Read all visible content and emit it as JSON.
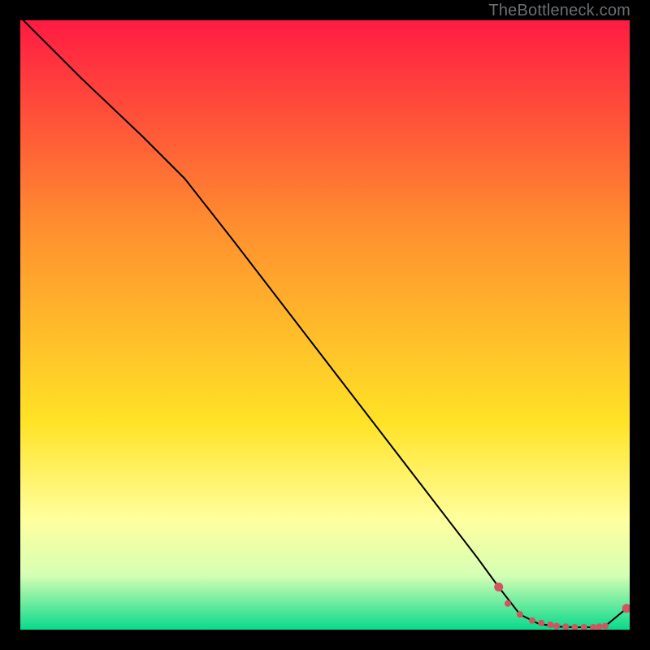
{
  "attribution": "TheBottleneck.com",
  "colors": {
    "gradient_top": "#ff1b43",
    "gradient_mid1": "#ff8f2f",
    "gradient_mid2": "#ffe326",
    "gradient_pale": "#ffff9e",
    "gradient_bottom": "#09d98c",
    "line": "#000000",
    "marker": "#d2545f"
  },
  "chart_data": {
    "type": "line",
    "title": "",
    "xlabel": "",
    "ylabel": "",
    "xlim": [
      0,
      100
    ],
    "ylim": [
      0,
      100
    ],
    "series": [
      {
        "name": "curve",
        "x": [
          0.5,
          10,
          20,
          27,
          35,
          45,
          55,
          65,
          75,
          78.5,
          82,
          85,
          88,
          91,
          94,
          96,
          99.5
        ],
        "y": [
          100,
          90.5,
          81,
          74,
          63.8,
          50.8,
          37.8,
          24.8,
          11.8,
          7,
          2.5,
          1,
          0.5,
          0.4,
          0.4,
          0.6,
          3.5
        ]
      }
    ],
    "markers": {
      "name": "highlight-cluster",
      "x": [
        78.5,
        80,
        82,
        84,
        85.5,
        87,
        88,
        89.5,
        91,
        92.5,
        94,
        95,
        96,
        99.5
      ],
      "y": [
        7,
        4.3,
        2.5,
        1.5,
        1.1,
        0.8,
        0.6,
        0.5,
        0.4,
        0.4,
        0.4,
        0.5,
        0.6,
        3.5
      ]
    }
  }
}
